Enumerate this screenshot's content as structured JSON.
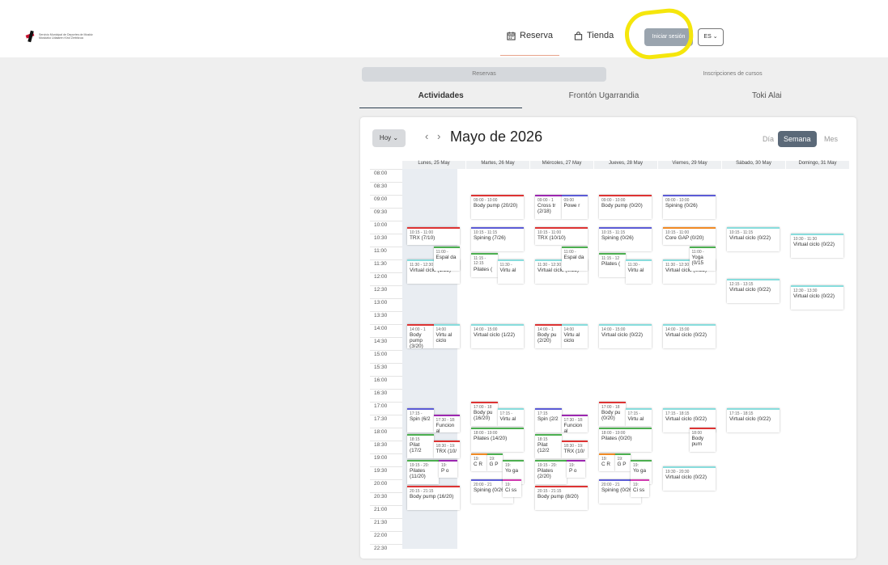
{
  "header": {
    "logo_line1": "Servicio Municipal de Deportes de Muskiz",
    "logo_line2": "Muskizko Udalaren Kirol Zerbitzua",
    "nav": [
      {
        "label": "Reserva",
        "icon": "calendar-icon"
      },
      {
        "label": "Tienda",
        "icon": "shopping-bag-icon"
      }
    ],
    "login_label": "Iniciar sesión",
    "lang_label": "ES ⌄"
  },
  "tabs": {
    "primary": [
      "Reservas",
      "Inscripciones de cursos"
    ],
    "secondary": [
      "Actividades",
      "Frontón Ugarrandia",
      "Toki Alai"
    ]
  },
  "calendar": {
    "today_label": "Hoy ⌄",
    "prev": "‹",
    "next": "›",
    "month": "Mayo de 2026",
    "views": [
      "Día",
      "Semana",
      "Mes"
    ],
    "days": [
      "Lunes, 25 May",
      "Martes, 26 May",
      "Miércoles, 27 May",
      "Jueves, 28 May",
      "Viernes, 29 May",
      "Sábado, 30 May",
      "Domingo, 31 May"
    ],
    "hours": [
      "08:00",
      "08:30",
      "09:00",
      "09:30",
      "10:00",
      "10:30",
      "11:00",
      "11:30",
      "12:00",
      "12:30",
      "13:00",
      "13:30",
      "14:00",
      "14:30",
      "15:00",
      "15:30",
      "16:00",
      "16:30",
      "17:00",
      "17:30",
      "18:00",
      "18:30",
      "19:00",
      "19:30",
      "20:00",
      "20:30",
      "21:00",
      "21:30",
      "22:00",
      "22:30"
    ],
    "events": [
      {
        "day": 1,
        "start": 9.0,
        "end": 10.0,
        "w": 1,
        "o": 0,
        "time": "09:00 - 10:00",
        "name": "Body pump (20/20)",
        "color": "#d33"
      },
      {
        "day": 1,
        "start": 10.25,
        "end": 11.25,
        "w": 1,
        "o": 0,
        "time": "10:15 - 11:15",
        "name": "Spining (7/26)",
        "color": "#5b5bd6"
      },
      {
        "day": 1,
        "start": 11.25,
        "end": 12.25,
        "w": 0.5,
        "o": 0,
        "time": "11:15 - 12:15",
        "name": "Pilates (",
        "color": "#4caf50"
      },
      {
        "day": 1,
        "start": 11.5,
        "end": 12.5,
        "w": 0.5,
        "o": 0.5,
        "time": "11:30 -",
        "name": "Virtu al",
        "color": "#8dd"
      },
      {
        "day": 1,
        "start": 14.0,
        "end": 15.0,
        "w": 1,
        "o": 0,
        "time": "14:00 - 15:00",
        "name": "Virtual ciclo (1/22)",
        "color": "#8dd"
      },
      {
        "day": 0,
        "start": 10.25,
        "end": 11.0,
        "w": 1,
        "o": 0,
        "time": "10:15 - 11:00",
        "name": "TRX (7/10)",
        "color": "#d33"
      },
      {
        "day": 0,
        "start": 11.0,
        "end": 12.0,
        "w": 0.5,
        "o": 0.5,
        "time": "11:00 -",
        "name": "Espal da",
        "color": "#4caf50"
      },
      {
        "day": 0,
        "start": 11.5,
        "end": 12.5,
        "w": 1,
        "o": 0,
        "time": "11:30 - 12:30",
        "name": "Virtual ciclo (1/22)",
        "color": "#8dd"
      },
      {
        "day": 0,
        "start": 14.0,
        "end": 15.0,
        "w": 0.5,
        "o": 0,
        "time": "14:00 - 1",
        "name": "Body pump (3/20)",
        "color": "#d33"
      },
      {
        "day": 0,
        "start": 14.0,
        "end": 15.0,
        "w": 0.5,
        "o": 0.5,
        "time": "14:00",
        "name": "Virtu al ciclo",
        "color": "#8dd"
      },
      {
        "day": 0,
        "start": 17.25,
        "end": 18.25,
        "w": 0.5,
        "o": 0,
        "time": "17:15 -",
        "name": "Spin (6/2",
        "color": "#5b5bd6"
      },
      {
        "day": 0,
        "start": 17.5,
        "end": 18.25,
        "w": 0.5,
        "o": 0.5,
        "time": "17:30 - 18:",
        "name": "Funcion al",
        "color": "#9c27b0"
      },
      {
        "day": 0,
        "start": 18.25,
        "end": 19.25,
        "w": 0.5,
        "o": 0,
        "time": "18:15",
        "name": "Pilat (17/2",
        "color": "#4caf50"
      },
      {
        "day": 0,
        "start": 18.5,
        "end": 19.25,
        "w": 0.5,
        "o": 0.5,
        "time": "18:30 - 19:",
        "name": "TRX (10/",
        "color": "#d33"
      },
      {
        "day": 0,
        "start": 19.25,
        "end": 20.25,
        "w": 0.6,
        "o": 0,
        "time": "19:15 - 20:",
        "name": "Pilates (11/20)",
        "color": "#4caf50"
      },
      {
        "day": 0,
        "start": 19.25,
        "end": 20.0,
        "w": 0.35,
        "o": 0.6,
        "time": "19:",
        "name": "P o",
        "color": "#9c27b0"
      },
      {
        "day": 0,
        "start": 20.25,
        "end": 21.25,
        "w": 1,
        "o": 0,
        "time": "20:15 - 21:15",
        "name": "Body pump (16/20)",
        "color": "#d33"
      },
      {
        "day": 2,
        "start": 9.0,
        "end": 10.0,
        "w": 0.5,
        "o": 0,
        "time": "09:00 - 1",
        "name": "Cross tr (2/18)",
        "color": "#9c27b0"
      },
      {
        "day": 2,
        "start": 9.0,
        "end": 10.0,
        "w": 0.5,
        "o": 0.5,
        "time": "09:00",
        "name": "Powe r",
        "color": "#5b5bd6"
      },
      {
        "day": 2,
        "start": 10.25,
        "end": 11.0,
        "w": 1,
        "o": 0,
        "time": "10:15 - 11:00",
        "name": "TRX (10/10)",
        "color": "#d33"
      },
      {
        "day": 2,
        "start": 11.0,
        "end": 12.0,
        "w": 0.5,
        "o": 0.5,
        "time": "11:00 -",
        "name": "Espal da",
        "color": "#4caf50"
      },
      {
        "day": 2,
        "start": 11.5,
        "end": 12.5,
        "w": 1,
        "o": 0,
        "time": "11:30 - 12:30",
        "name": "Virtual ciclo (0/22)",
        "color": "#8dd"
      },
      {
        "day": 2,
        "start": 14.0,
        "end": 15.0,
        "w": 0.5,
        "o": 0,
        "time": "14:00 - 1",
        "name": "Body pu (2/20)",
        "color": "#d33"
      },
      {
        "day": 2,
        "start": 14.0,
        "end": 15.0,
        "w": 0.5,
        "o": 0.5,
        "time": "14:00",
        "name": "Virtu al ciclo",
        "color": "#8dd"
      },
      {
        "day": 3,
        "start": 9.0,
        "end": 10.0,
        "w": 1,
        "o": 0,
        "time": "09:00 - 10:00",
        "name": "Body pump (0/20)",
        "color": "#d33"
      },
      {
        "day": 3,
        "start": 10.25,
        "end": 11.25,
        "w": 1,
        "o": 0,
        "time": "10:15 - 11:15",
        "name": "Spining (0/26)",
        "color": "#5b5bd6"
      },
      {
        "day": 3,
        "start": 11.25,
        "end": 12.25,
        "w": 0.5,
        "o": 0,
        "time": "11:15 - 12",
        "name": "Pilates (",
        "color": "#4caf50"
      },
      {
        "day": 3,
        "start": 11.5,
        "end": 12.5,
        "w": 0.5,
        "o": 0.5,
        "time": "11:30 -",
        "name": "Virtu al",
        "color": "#8dd"
      },
      {
        "day": 3,
        "start": 14.0,
        "end": 15.0,
        "w": 1,
        "o": 0,
        "time": "14:00 - 15:00",
        "name": "Virtual ciclo (0/22)",
        "color": "#8dd"
      },
      {
        "day": 4,
        "start": 9.0,
        "end": 10.0,
        "w": 1,
        "o": 0,
        "time": "09:00 - 10:00",
        "name": "Spining (0/26)",
        "color": "#5b5bd6"
      },
      {
        "day": 4,
        "start": 10.25,
        "end": 11.0,
        "w": 1,
        "o": 0,
        "time": "10:15 - 11:00",
        "name": "Core GAP (0/20)",
        "color": "#f08a24"
      },
      {
        "day": 4,
        "start": 11.0,
        "end": 12.0,
        "w": 0.5,
        "o": 0.5,
        "time": "11:00 -",
        "name": "Yoga (0/15",
        "color": "#4caf50"
      },
      {
        "day": 4,
        "start": 11.5,
        "end": 12.5,
        "w": 1,
        "o": 0,
        "time": "11:30 - 12:30",
        "name": "Virtual ciclo (0/22)",
        "color": "#8dd"
      },
      {
        "day": 4,
        "start": 14.0,
        "end": 15.0,
        "w": 1,
        "o": 0,
        "time": "14:00 - 15:00",
        "name": "Virtual ciclo (0/22)",
        "color": "#8dd"
      },
      {
        "day": 5,
        "start": 10.25,
        "end": 11.25,
        "w": 1,
        "o": 0,
        "time": "10:15 - 11:15",
        "name": "Virtual ciclo (0/22)",
        "color": "#8dd"
      },
      {
        "day": 5,
        "start": 12.25,
        "end": 13.25,
        "w": 1,
        "o": 0,
        "time": "12:15 - 13:15",
        "name": "Virtual ciclo (0/22)",
        "color": "#8dd"
      },
      {
        "day": 6,
        "start": 10.5,
        "end": 11.5,
        "w": 1,
        "o": 0,
        "time": "10:30 - 11:30",
        "name": "Virtual ciclo (0/22)",
        "color": "#8dd"
      },
      {
        "day": 6,
        "start": 12.5,
        "end": 13.5,
        "w": 1,
        "o": 0,
        "time": "12:30 - 13:30",
        "name": "Virtual ciclo (0/22)",
        "color": "#8dd"
      },
      {
        "day": 1,
        "start": 17.0,
        "end": 18.0,
        "w": 0.5,
        "o": 0,
        "time": "17:00 - 18",
        "name": "Body pu (16/20)",
        "color": "#d33"
      },
      {
        "day": 1,
        "start": 17.25,
        "end": 18.0,
        "w": 0.5,
        "o": 0.5,
        "time": "17:15 -",
        "name": "Virtu al",
        "color": "#8dd"
      },
      {
        "day": 1,
        "start": 18.0,
        "end": 19.0,
        "w": 1,
        "o": 0,
        "time": "18:00 - 19:00",
        "name": "Pilates (14/20)",
        "color": "#4caf50"
      },
      {
        "day": 1,
        "start": 19.0,
        "end": 19.75,
        "w": 0.3,
        "o": 0,
        "time": "19:",
        "name": "C R",
        "color": "#f08a24"
      },
      {
        "day": 1,
        "start": 19.0,
        "end": 19.75,
        "w": 0.3,
        "o": 0.3,
        "time": "19:",
        "name": "G P",
        "color": "#4caf50"
      },
      {
        "day": 1,
        "start": 19.25,
        "end": 20.25,
        "w": 0.4,
        "o": 0.6,
        "time": "19:",
        "name": "Yo ga",
        "color": "#4caf50"
      },
      {
        "day": 1,
        "start": 20.0,
        "end": 21.0,
        "w": 0.8,
        "o": 0,
        "time": "20:00 - 21",
        "name": "Spining (0/26)",
        "color": "#5b5bd6"
      },
      {
        "day": 1,
        "start": 20.0,
        "end": 20.75,
        "w": 0.35,
        "o": 0.6,
        "time": "19:",
        "name": "Ci ss",
        "color": "#d03ab0"
      },
      {
        "day": 2,
        "start": 17.25,
        "end": 18.25,
        "w": 0.5,
        "o": 0,
        "time": "17:15",
        "name": "Spin (2/2",
        "color": "#5b5bd6"
      },
      {
        "day": 2,
        "start": 17.5,
        "end": 18.25,
        "w": 0.5,
        "o": 0.5,
        "time": "17:30 - 18:",
        "name": "Funcion al",
        "color": "#9c27b0"
      },
      {
        "day": 2,
        "start": 18.25,
        "end": 19.25,
        "w": 0.5,
        "o": 0,
        "time": "18:15",
        "name": "Pilat (12/2",
        "color": "#4caf50"
      },
      {
        "day": 2,
        "start": 18.5,
        "end": 19.25,
        "w": 0.5,
        "o": 0.5,
        "time": "18:30 - 19:",
        "name": "TRX (10/",
        "color": "#d33"
      },
      {
        "day": 2,
        "start": 19.25,
        "end": 20.25,
        "w": 0.6,
        "o": 0,
        "time": "19:15 - 20:",
        "name": "Pilates (2/20)",
        "color": "#4caf50"
      },
      {
        "day": 2,
        "start": 19.25,
        "end": 20.0,
        "w": 0.35,
        "o": 0.6,
        "time": "19:",
        "name": "P o",
        "color": "#9c27b0"
      },
      {
        "day": 2,
        "start": 20.25,
        "end": 21.25,
        "w": 1,
        "o": 0,
        "time": "20:15 - 21:15",
        "name": "Body pump (8/20)",
        "color": "#d33"
      },
      {
        "day": 3,
        "start": 17.0,
        "end": 18.0,
        "w": 0.5,
        "o": 0,
        "time": "17:00 - 18",
        "name": "Body pu (0/20)",
        "color": "#d33"
      },
      {
        "day": 3,
        "start": 17.25,
        "end": 18.0,
        "w": 0.5,
        "o": 0.5,
        "time": "17:15 -",
        "name": "Virtu al",
        "color": "#8dd"
      },
      {
        "day": 3,
        "start": 18.0,
        "end": 19.0,
        "w": 1,
        "o": 0,
        "time": "18:00 - 19:00",
        "name": "Pilates (0/20)",
        "color": "#4caf50"
      },
      {
        "day": 3,
        "start": 19.0,
        "end": 19.75,
        "w": 0.3,
        "o": 0,
        "time": "19:",
        "name": "C R",
        "color": "#f08a24"
      },
      {
        "day": 3,
        "start": 19.0,
        "end": 19.75,
        "w": 0.3,
        "o": 0.3,
        "time": "19:",
        "name": "G P",
        "color": "#4caf50"
      },
      {
        "day": 3,
        "start": 19.25,
        "end": 20.25,
        "w": 0.4,
        "o": 0.6,
        "time": "19:",
        "name": "Yo ga",
        "color": "#4caf50"
      },
      {
        "day": 3,
        "start": 20.0,
        "end": 21.0,
        "w": 0.8,
        "o": 0,
        "time": "20:00 - 21",
        "name": "Spining (0/26)",
        "color": "#5b5bd6"
      },
      {
        "day": 3,
        "start": 20.0,
        "end": 20.75,
        "w": 0.35,
        "o": 0.6,
        "time": "19:",
        "name": "Ci ss",
        "color": "#d03ab0"
      },
      {
        "day": 4,
        "start": 17.25,
        "end": 18.25,
        "w": 1,
        "o": 0,
        "time": "17:15 - 18:15",
        "name": "Virtual ciclo (0/22)",
        "color": "#8dd"
      },
      {
        "day": 4,
        "start": 18.0,
        "end": 19.0,
        "w": 0.5,
        "o": 0.5,
        "time": "18:00",
        "name": "Body pum",
        "color": "#d33"
      },
      {
        "day": 4,
        "start": 19.5,
        "end": 20.5,
        "w": 1,
        "o": 0,
        "time": "19:30 - 20:30",
        "name": "Virtual ciclo (0/22)",
        "color": "#8dd"
      },
      {
        "day": 5,
        "start": 17.25,
        "end": 18.25,
        "w": 1,
        "o": 0,
        "time": "17:15 - 18:15",
        "name": "Virtual ciclo (0/22)",
        "color": "#8dd"
      }
    ]
  }
}
